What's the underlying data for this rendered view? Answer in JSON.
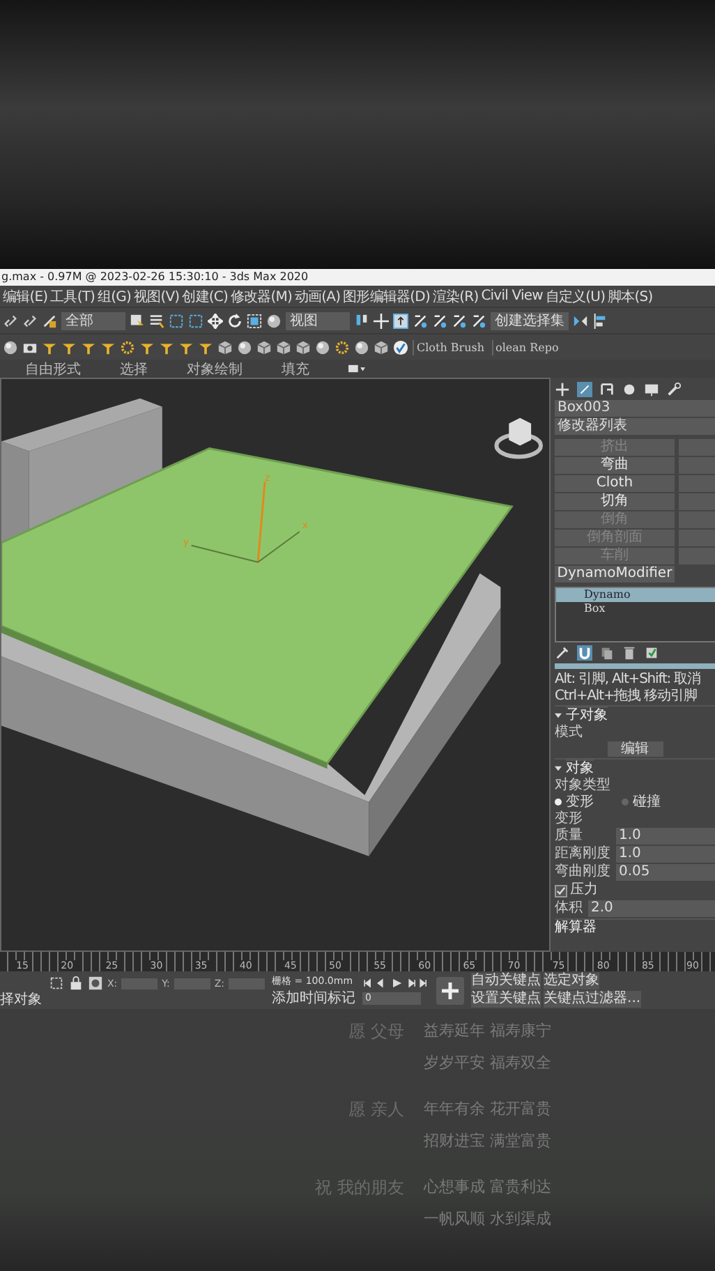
{
  "window": {
    "title": "g.max - 0.97M @ 2023-02-26 15:30:10 - 3ds Max 2020"
  },
  "menu": [
    "编辑(E)",
    "工具(T)",
    "组(G)",
    "视图(V)",
    "创建(C)",
    "修改器(M)",
    "动画(A)",
    "图形编辑器(D)",
    "渲染(R)",
    "Civil View",
    "自定义(U)",
    "脚本(S)"
  ],
  "toolbar_1": {
    "dropdowns": [
      "全部",
      "视图",
      "创建选择集"
    ]
  },
  "toolbar_2": {
    "buttons": [
      "Cloth Brush",
      "olean Repo"
    ]
  },
  "ribbon": {
    "tabs": [
      "自由形式",
      "选择",
      "对象绘制",
      "填充"
    ]
  },
  "viewport": {
    "gizmo_labels": [
      "z",
      "x",
      "y"
    ]
  },
  "command_panel": {
    "object_name": "Box003",
    "modifier_list": "修改器列表",
    "modifier_buttons": [
      {
        "label": "挤出",
        "disabled": true
      },
      {
        "label": "弯曲",
        "disabled": false
      },
      {
        "label": "Cloth",
        "disabled": false
      },
      {
        "label": "切角",
        "disabled": false
      },
      {
        "label": "倒角",
        "disabled": true
      },
      {
        "label": "倒角剖面",
        "disabled": true
      },
      {
        "label": "车削",
        "disabled": true
      },
      {
        "label": "DynamoModifier",
        "disabled": false
      }
    ],
    "stack": [
      {
        "label": "Dynamo",
        "selected": true
      },
      {
        "label": "Box",
        "selected": false
      }
    ],
    "progress": {
      "level": 1
    },
    "hints": [
      "Alt: 引脚, Alt+Shift: 取消",
      "Ctrl+Alt+拖拽 移动引脚"
    ],
    "subobject": {
      "title": "子对象",
      "mode_label": "模式",
      "button": "编辑"
    },
    "object": {
      "title": "对象",
      "type_label": "对象类型",
      "types": [
        {
          "label": "变形",
          "selected": true
        },
        {
          "label": "碰撞",
          "selected": false
        }
      ],
      "group_label": "变形",
      "params": [
        {
          "label": "质量",
          "value": "1.0"
        },
        {
          "label": "距离刚度",
          "value": "1.0"
        },
        {
          "label": "弯曲刚度",
          "value": "0.05"
        }
      ],
      "pressure": {
        "label": "压力",
        "checked": true
      },
      "volume": {
        "label": "体积",
        "value": "2.0"
      }
    },
    "solver": "解算器"
  },
  "timeline": {
    "ticks": [
      "15",
      "20",
      "25",
      "30",
      "35",
      "40",
      "45",
      "50",
      "55",
      "60",
      "65",
      "70",
      "75",
      "80",
      "85",
      "90"
    ]
  },
  "status": {
    "left_text": "择对象",
    "x_label": "X:",
    "y_label": "Y:",
    "z_label": "Z:",
    "grid": "栅格 = 100.0mm",
    "add_time_tag": "添加时间标记",
    "frame": "0",
    "auto_key": "自动关键点",
    "selected_object": "选定对象",
    "set_key": "设置关键点",
    "key_filters": "关键点过滤器..."
  },
  "lyrics": [
    {
      "who": "愿 父母",
      "lines": [
        "益寿延年 福寿康宁",
        "岁岁平安 福寿双全"
      ]
    },
    {
      "who": "愿 亲人",
      "lines": [
        "年年有余 花开富贵",
        "招财进宝 满堂富贵"
      ]
    },
    {
      "who": "祝 我的朋友",
      "lines": [
        "心想事成 富贵利达",
        "一帆风顺 水到渠成"
      ]
    }
  ]
}
